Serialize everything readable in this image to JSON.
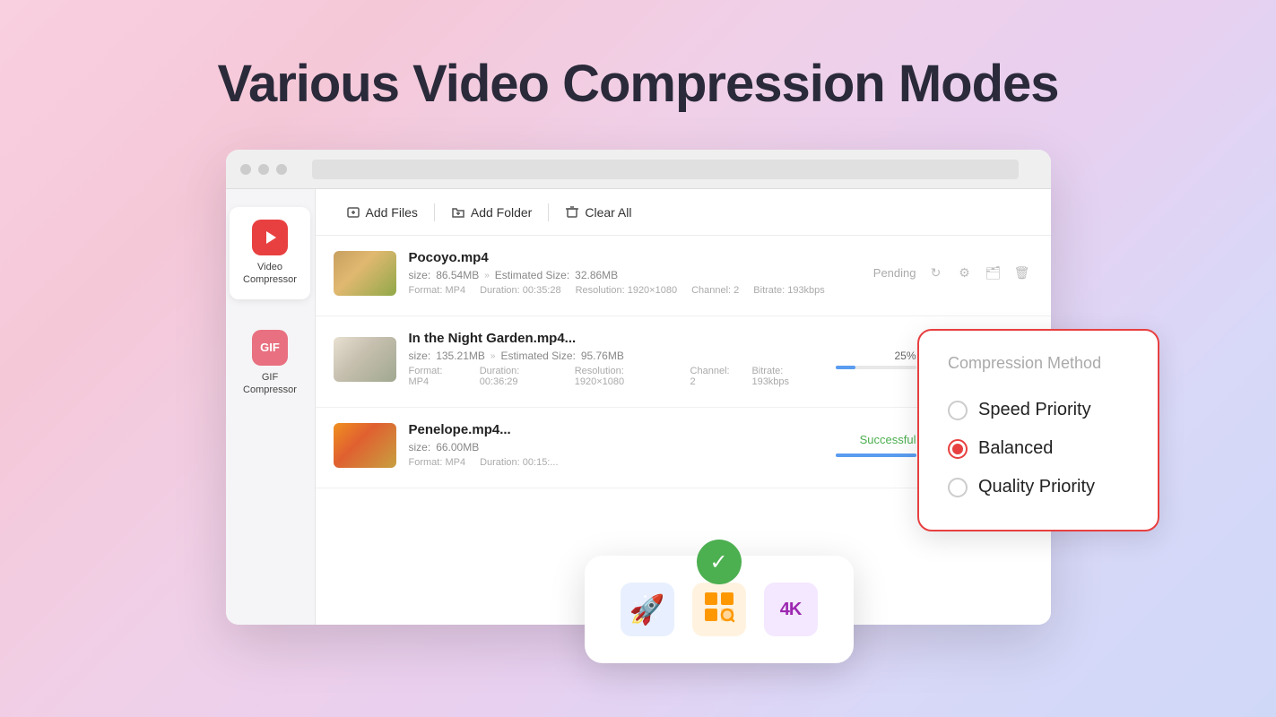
{
  "page": {
    "title": "Various Video Compression Modes",
    "background": "linear-gradient(135deg, #f9d0e0, #f5c8d8, #f0d0e8, #e8d0f0, #d8d8f8, #d0d8f8)"
  },
  "sidebar": {
    "items": [
      {
        "id": "video-compressor",
        "label": "Video\nCompressor",
        "icon": "▶",
        "active": true
      },
      {
        "id": "gif-compressor",
        "label": "GIF\nCompressor",
        "icon": "GIF",
        "active": false
      }
    ]
  },
  "toolbar": {
    "add_files_label": "Add Files",
    "add_folder_label": "Add Folder",
    "clear_all_label": "Clear All"
  },
  "files": [
    {
      "id": "file-1",
      "name": "Pocoyo.mp4",
      "size": "86.54MB",
      "estimated_size": "32.86MB",
      "format": "MP4",
      "duration": "00:35:28",
      "resolution": "1920×1080",
      "channel": "2",
      "bitrate": "193kbps",
      "status": "Pending",
      "thumb_class": "file-thumb-hay"
    },
    {
      "id": "file-2",
      "name": "In the Night Garden.mp4...",
      "size": "135.21MB",
      "estimated_size": "95.76MB",
      "format": "MP4",
      "duration": "00:36:29",
      "resolution": "1920×1080",
      "channel": "2",
      "bitrate": "193kbps",
      "status": "25%",
      "progress": 25,
      "thumb_class": "file-thumb-night"
    },
    {
      "id": "file-3",
      "name": "Penelope.mp4...",
      "size": "66.00MB",
      "estimated_size": "",
      "format": "MP4",
      "duration": "00:15:...",
      "resolution": "",
      "channel": "",
      "bitrate": "",
      "status": "Successful",
      "thumb_class": "file-thumb-sunset"
    }
  ],
  "compression_panel": {
    "title": "Compression Method",
    "options": [
      {
        "id": "speed-priority",
        "label": "Speed Priority",
        "selected": false
      },
      {
        "id": "balanced",
        "label": "Balanced",
        "selected": true
      },
      {
        "id": "quality-priority",
        "label": "Quality Priority",
        "selected": false
      }
    ]
  },
  "success_popup": {
    "icons": [
      {
        "id": "rocket",
        "symbol": "🚀",
        "color_class": "blue"
      },
      {
        "id": "grid-search",
        "symbol": "⊞",
        "color_class": "orange"
      },
      {
        "id": "4k",
        "symbol": "4K",
        "color_class": "purple"
      }
    ]
  }
}
